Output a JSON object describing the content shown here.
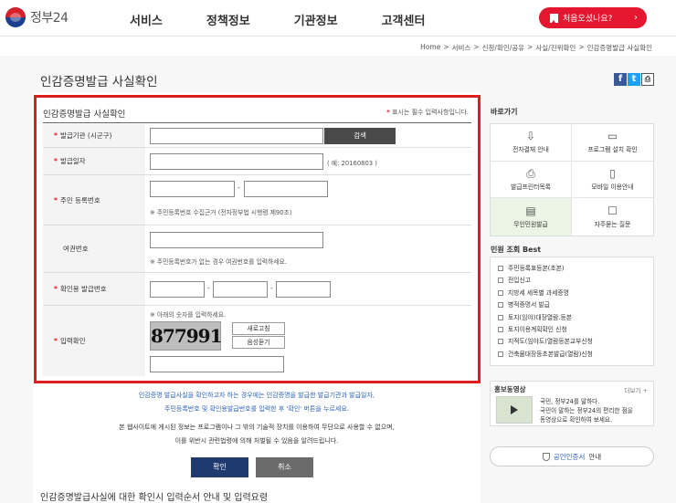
{
  "header": {
    "logo_text": "정부24",
    "nav": [
      "서비스",
      "정책정보",
      "기관정보",
      "고객센터"
    ],
    "first_visit_label": "처음오셨나요?"
  },
  "breadcrumb": [
    "Home",
    ">",
    "서비스",
    ">",
    "신청/확인/공유",
    ">",
    "사실/진위확인",
    ">",
    "인감증명발급 사실확인"
  ],
  "page": {
    "title": "인감증명발급 사실확인",
    "share": [
      "f",
      "t",
      "⎙"
    ]
  },
  "form": {
    "title": "인감증명발급 사실확인",
    "required_note_star": "*",
    "required_note": "표시는 필수 입력사항입니다.",
    "labels": {
      "issuer": "발급기관 (시군구)",
      "issue_date": "발급일자",
      "resident_no": "주민 등록번호",
      "passport_no": "여권번호",
      "confirm_no": "확인용 발급번호",
      "captcha": "입력확인"
    },
    "search_label": "검색",
    "issue_date_hint": "( 예: 20160803 )",
    "resident_hint": "※ 주민등록번호 수집근거 (전자정부법 시행령 제90조)",
    "passport_hint": "※ 주민등록번호가 없는 경우 여권번호를 입력하세요.",
    "captcha_hint": "※ 아래의 숫자를 입력하세요.",
    "captcha_text": "877991",
    "refresh_label": "새로고침",
    "audio_label": "음성듣기",
    "dash": "-"
  },
  "notice": {
    "line1": "인감증명 발급사실을 확인하고자 하는 경우에는 인감증명을 발급한 발급기관과 발급일자,",
    "line2": "주민등록번호 및 확인용발급번호를 입력한 후 '확인' 버튼을 누르세요.",
    "line3": "본 웹사이트에 게시된 정보는 프로그램이나 그 밖의 기술적 장치를 이용하여 무단으로 사용할 수 없으며,",
    "line4": "이를 위반시 관련법령에 의해 처벌될 수 있음을 알려드립니다."
  },
  "actions": {
    "confirm": "확인",
    "cancel": "취소"
  },
  "bottom_title": "인감증명발급사실에 대한 확인시 입력순서 안내 및 입력요령",
  "sidebar": {
    "quick_title": "바로가기",
    "quick": [
      {
        "label": "전자결재 안내",
        "icon": "⇩"
      },
      {
        "label": "프로그램 설치 확인",
        "icon": "▭"
      },
      {
        "label": "발급프린터목록",
        "icon": "⎙"
      },
      {
        "label": "모바일 이용안내",
        "icon": "▯"
      },
      {
        "label": "무인민원발급",
        "icon": "▤"
      },
      {
        "label": "자주묻는 질문",
        "icon": "☐"
      }
    ],
    "best_title": "민원 조회 Best",
    "best": [
      "주민등록표등본(초본)",
      "전입신고",
      "지방세 세목별 과세증명",
      "병적증명서 발급",
      "토지(임야)대장열람.등본",
      "토지이용계획확인 신청",
      "지적도(임야도)열람등본교부신청",
      "건축물대장등초본발급(열람)신청"
    ],
    "promo_title": "홍보동영상",
    "promo_more": "더보기 +",
    "promo_text": [
      "국민, 정부24를 말하다.",
      "국민이 말하는 정부24의 편리한 점을",
      "동영상으로 확인하여 보세요."
    ],
    "cert_blue": "공인인증서",
    "cert_rest": "안내"
  }
}
